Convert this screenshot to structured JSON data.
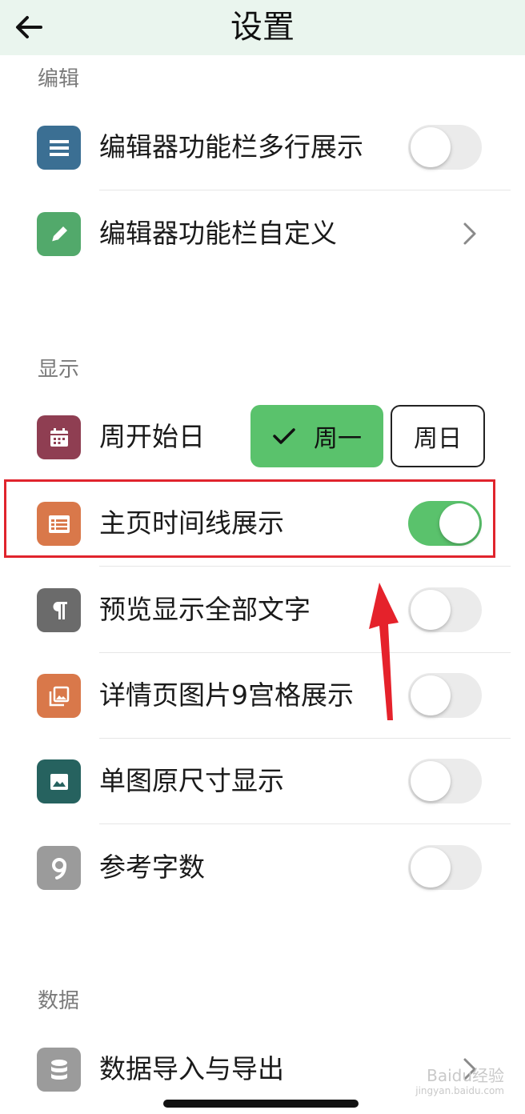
{
  "header": {
    "title": "设置"
  },
  "sections": [
    {
      "label": "编辑"
    },
    {
      "label": "显示"
    },
    {
      "label": "数据"
    }
  ],
  "rows": {
    "toolbar_multiline": {
      "label": "编辑器功能栏多行展示",
      "enabled": false
    },
    "toolbar_custom": {
      "label": "编辑器功能栏自定义"
    },
    "week_start": {
      "label": "周开始日",
      "option_monday": "周一",
      "option_sunday": "周日",
      "selected": "周一"
    },
    "home_timeline": {
      "label": "主页时间线展示",
      "enabled": true
    },
    "preview_full_text": {
      "label": "预览显示全部文字",
      "enabled": false
    },
    "detail_grid": {
      "label": "详情页图片9宫格展示",
      "enabled": false
    },
    "single_image": {
      "label": "单图原尺寸显示",
      "enabled": false
    },
    "word_count": {
      "label": "参考字数",
      "enabled": false
    },
    "data_import_export": {
      "label": "数据导入与导出"
    }
  },
  "watermark": {
    "text": "Baidu经验",
    "sub": "jingyan.baidu.com"
  },
  "colors": {
    "accent": "#5ac26c",
    "header_bg": "#eaf5ee",
    "highlight": "#e0242d",
    "icon_blue": "#3b6f93",
    "icon_green": "#52a96b",
    "icon_maroon": "#8f3e52",
    "icon_orange": "#d9784a",
    "icon_gray": "#6b6b6b",
    "icon_teal": "#26625f",
    "icon_lightgray": "#9b9b9b"
  },
  "icons": [
    "back-arrow-icon",
    "menu-lines-icon",
    "pencil-icon",
    "calendar-icon",
    "list-icon",
    "pilcrow-icon",
    "photo-grid-icon",
    "image-icon",
    "number-nine-icon",
    "database-icon",
    "chevron-right-icon",
    "check-icon"
  ]
}
